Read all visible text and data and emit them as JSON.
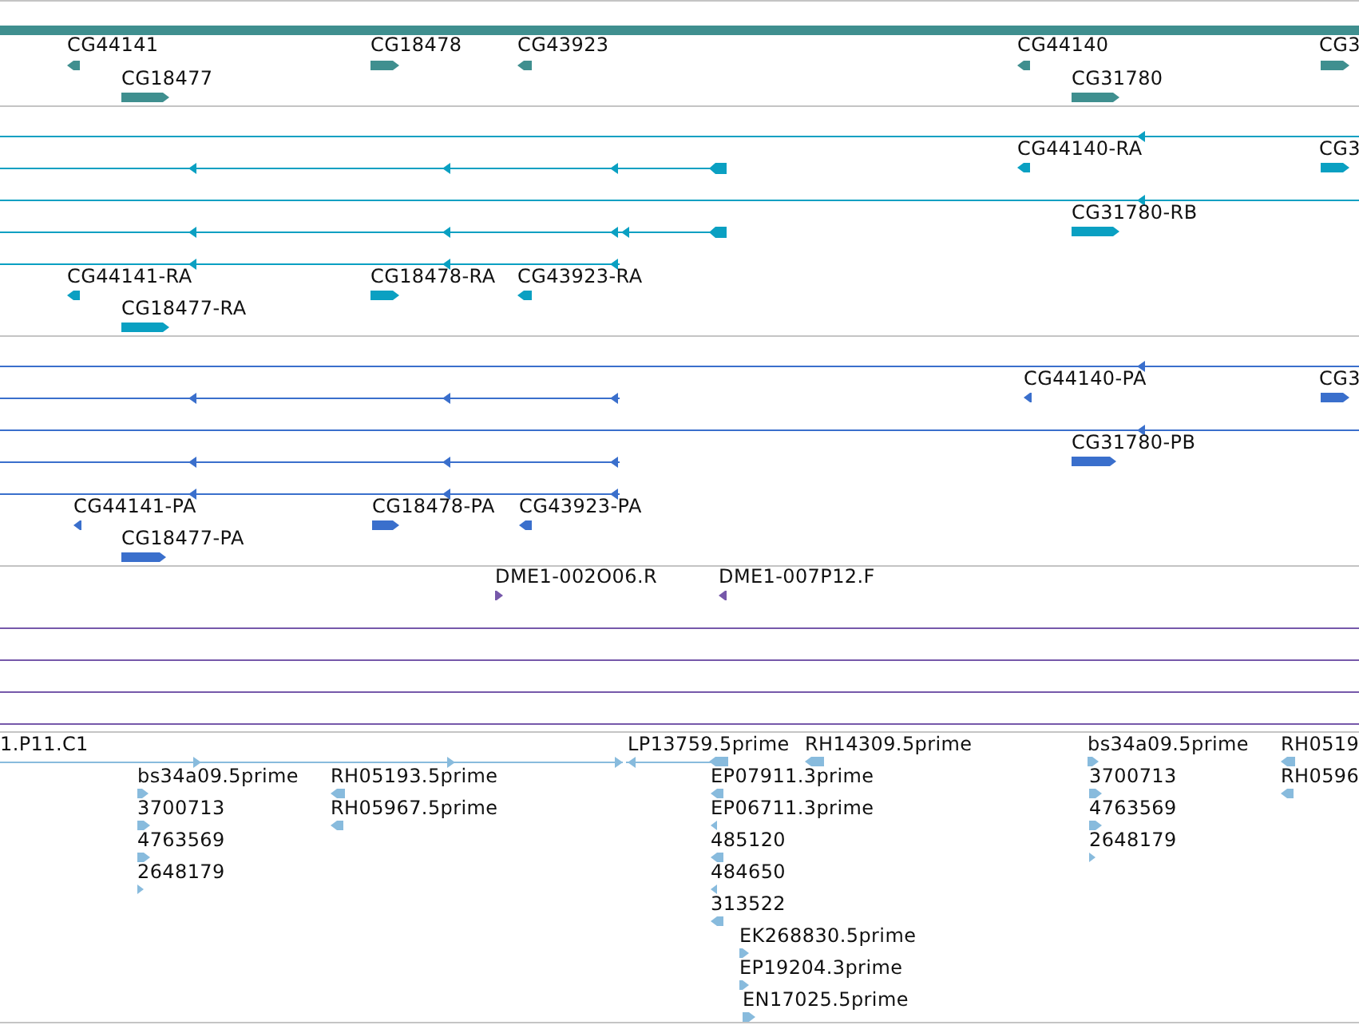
{
  "tracks": [
    {
      "kind": "gene",
      "color": "#3f8f8f",
      "features": [
        {
          "label": "CG44141",
          "reverse": true
        },
        {
          "label": "CG18477",
          "reverse": false
        },
        {
          "label": "CG18478",
          "reverse": false
        },
        {
          "label": "CG43923",
          "reverse": true
        },
        {
          "label": "CG44140",
          "reverse": true
        },
        {
          "label": "CG31780",
          "reverse": false
        },
        {
          "label": "CG3",
          "reverse": false
        }
      ]
    },
    {
      "kind": "transcript",
      "color": "#0aa0c2",
      "features": [
        {
          "label": "CG44140-RA",
          "reverse": true
        },
        {
          "label": "CG3",
          "reverse": false
        },
        {
          "label": "CG31780-RB",
          "reverse": false
        },
        {
          "label": "CG44141-RA",
          "reverse": true
        },
        {
          "label": "CG18478-RA",
          "reverse": false
        },
        {
          "label": "CG43923-RA",
          "reverse": true
        },
        {
          "label": "CG18477-RA",
          "reverse": false
        }
      ]
    },
    {
      "kind": "transcript",
      "color": "#3a6fcc",
      "features": [
        {
          "label": "CG44140-PA",
          "reverse": true
        },
        {
          "label": "CG3",
          "reverse": false
        },
        {
          "label": "CG31780-PB",
          "reverse": false
        },
        {
          "label": "CG44141-PA",
          "reverse": true
        },
        {
          "label": "CG18478-PA",
          "reverse": false
        },
        {
          "label": "CG43923-PA",
          "reverse": true
        },
        {
          "label": "CG18477-PA",
          "reverse": false
        }
      ]
    },
    {
      "kind": "clone",
      "color": "#7658aa",
      "features": [
        {
          "label": "DME1-002O06.R",
          "reverse": false
        },
        {
          "label": "DME1-007P12.F",
          "reverse": true
        }
      ]
    },
    {
      "kind": "est",
      "color": "#88bbdd",
      "features": [
        {
          "label": "1.P11.C1"
        },
        {
          "label": "LP13759.5prime",
          "reverse": true
        },
        {
          "label": "RH14309.5prime",
          "reverse": true
        },
        {
          "label": "bs34a09.5prime",
          "reverse": false
        },
        {
          "label": "3700713",
          "reverse": false
        },
        {
          "label": "4763569",
          "reverse": false
        },
        {
          "label": "2648179",
          "reverse": false
        },
        {
          "label": "RH05193.5prime",
          "reverse": true
        },
        {
          "label": "RH05967.5prime",
          "reverse": true
        },
        {
          "label": "EP07911.3prime",
          "reverse": true
        },
        {
          "label": "EP06711.3prime",
          "reverse": true
        },
        {
          "label": "485120",
          "reverse": true
        },
        {
          "label": "484650",
          "reverse": true
        },
        {
          "label": "313522",
          "reverse": true
        },
        {
          "label": "EK268830.5prime",
          "reverse": false
        },
        {
          "label": "EP19204.3prime",
          "reverse": false
        },
        {
          "label": "EN17025.5prime",
          "reverse": false
        },
        {
          "label": "bs34a09.5prime",
          "reverse": false
        },
        {
          "label": "3700713",
          "reverse": false
        },
        {
          "label": "4763569",
          "reverse": false
        },
        {
          "label": "2648179",
          "reverse": false
        },
        {
          "label": "RH0519",
          "reverse": true
        },
        {
          "label": "RH0596",
          "reverse": true
        }
      ]
    }
  ]
}
